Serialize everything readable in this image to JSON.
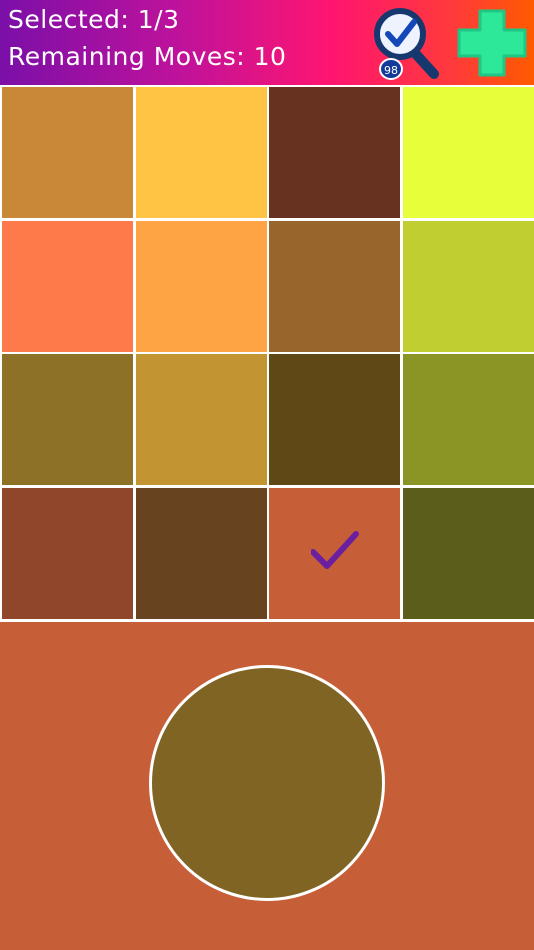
{
  "header": {
    "selected_text": "Selected: 1/3",
    "moves_text": "Remaining Moves: 10",
    "hint_count": "98",
    "hint_icon": "magnifier-check-icon",
    "add_icon": "plus-icon"
  },
  "colors": {
    "header_gradient": [
      "#7a0fa8",
      "#ff1570",
      "#ff5a00"
    ],
    "background": "#c65f38",
    "target": "#7f6423",
    "add_button": "#2ee89a",
    "check_mark": "#6a1fa0"
  },
  "board": {
    "rows": 4,
    "cols": 4,
    "tiles": [
      {
        "color": "#c98838",
        "selected": false
      },
      {
        "color": "#ffc444",
        "selected": false
      },
      {
        "color": "#683220",
        "selected": false
      },
      {
        "color": "#e6ff3a",
        "selected": false
      },
      {
        "color": "#ff7a4a",
        "selected": false
      },
      {
        "color": "#ffa444",
        "selected": false
      },
      {
        "color": "#98652c",
        "selected": false
      },
      {
        "color": "#c0ce32",
        "selected": false
      },
      {
        "color": "#8c7126",
        "selected": false
      },
      {
        "color": "#c29432",
        "selected": false
      },
      {
        "color": "#5f4816",
        "selected": false
      },
      {
        "color": "#8a9526",
        "selected": false
      },
      {
        "color": "#90462a",
        "selected": false
      },
      {
        "color": "#67431f",
        "selected": false
      },
      {
        "color": "#c65f38",
        "selected": true
      },
      {
        "color": "#5a5e1a",
        "selected": false
      }
    ]
  }
}
